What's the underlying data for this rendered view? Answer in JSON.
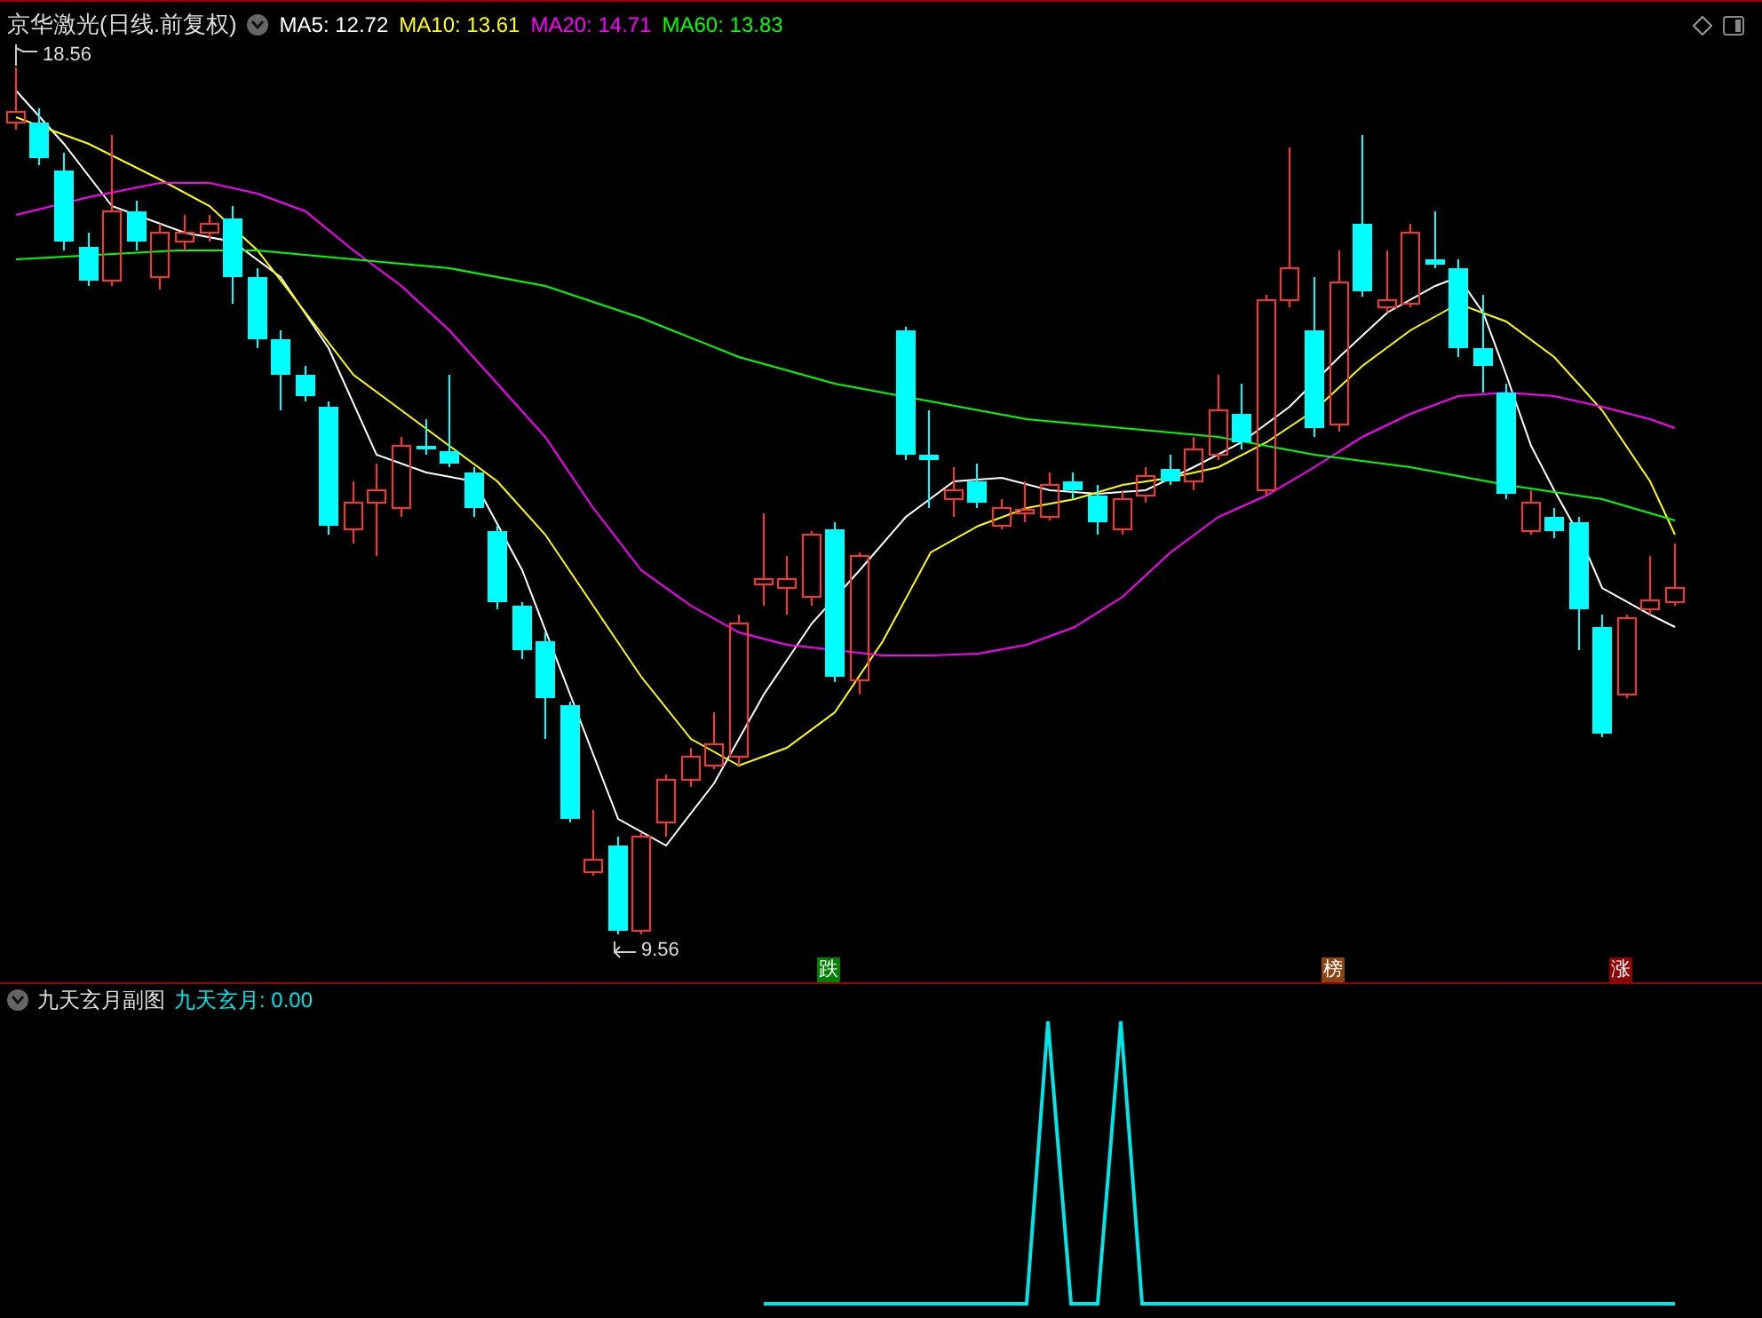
{
  "header": {
    "title": "京华激光(日线.前复权)",
    "ma": [
      {
        "label": "MA5: 12.72",
        "color": "#ffffff"
      },
      {
        "label": "MA10: 13.61",
        "color": "#ffff00"
      },
      {
        "label": "MA20: 14.71",
        "color": "#ff00ff"
      },
      {
        "label": "MA60: 13.83",
        "color": "#00ff00"
      }
    ]
  },
  "price_markers": {
    "high": "18.56",
    "low": "9.56"
  },
  "event_tags": [
    {
      "label": "跌",
      "color": "#008000"
    },
    {
      "label": "榜",
      "color": "#8b4513"
    },
    {
      "label": "涨",
      "color": "#8b0000"
    }
  ],
  "sub_panel": {
    "title": "九天玄月副图",
    "indicator": "九天玄月: 0.00"
  }
}
